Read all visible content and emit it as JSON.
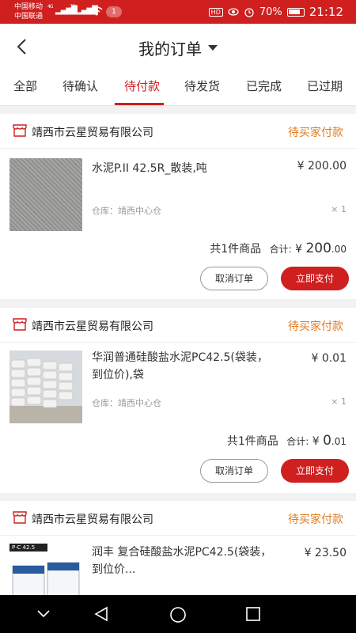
{
  "status_bar": {
    "carrier1": "中国移动",
    "carrier2": "中国联通",
    "net1": "4G",
    "net2": "3G",
    "notification_count": "1",
    "hd": "HD",
    "battery": "70%",
    "time": "21:12"
  },
  "header": {
    "title": "我的订单"
  },
  "tabs": [
    "全部",
    "待确认",
    "待付款",
    "待发货",
    "已完成",
    "已过期"
  ],
  "active_tab": 2,
  "orders": [
    {
      "shop": "靖西市云星贸易有限公司",
      "status": "待买家付款",
      "product": "水泥P.II 42.5R_散装,吨",
      "price": "¥ 200.00",
      "warehouse": "仓库：靖西中心仓",
      "qty": "× 1",
      "count_text": "共1件商品",
      "total_label": "合计:",
      "total_currency": "¥",
      "total_int": "200",
      "total_dec": ".00",
      "cancel": "取消订单",
      "pay": "立即支付"
    },
    {
      "shop": "靖西市云星贸易有限公司",
      "status": "待买家付款",
      "product": "华润普通硅酸盐水泥PC42.5(袋装，到位价),袋",
      "price": "¥ 0.01",
      "warehouse": "仓库：靖西中心仓",
      "qty": "× 1",
      "count_text": "共1件商品",
      "total_label": "合计:",
      "total_currency": "¥",
      "total_int": "0",
      "total_dec": ".01",
      "cancel": "取消订单",
      "pay": "立即支付"
    },
    {
      "shop": "靖西市云星贸易有限公司",
      "status": "待买家付款",
      "product": "润丰 复合硅酸盐水泥PC42.5(袋装，到位价...",
      "price": "¥ 23.50",
      "product_image_label": "P·C 42.5"
    }
  ],
  "colors": {
    "accent": "#cf1f1f",
    "status_orange": "#e07b22"
  }
}
